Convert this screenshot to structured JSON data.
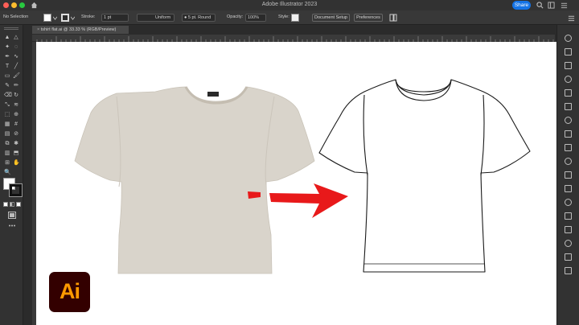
{
  "window": {
    "title": "Adobe Illustrator 2023",
    "share_label": "Share"
  },
  "control_bar": {
    "selection_label": "No Selection",
    "stroke_label": "Stroke:",
    "stroke_weight": "1 pt",
    "profile_value": "Uniform",
    "brush_value": "5 pt. Round",
    "opacity_label": "Opacity:",
    "opacity_value": "100%",
    "style_label": "Style:",
    "document_setup_label": "Document Setup",
    "preferences_label": "Preferences"
  },
  "document_tab": {
    "label": "tshirt flat.ai @ 33.33 % (RGB/Preview)"
  },
  "artwork": {
    "logo_text": "Ai",
    "photo_tshirt_color": "#d9d4cb",
    "arrow_color": "#e8191a",
    "logo_bg": "#330000",
    "logo_fg": "#ff9a00"
  },
  "icons": {
    "left_toolbar": [
      "selection-tool-icon",
      "direct-selection-tool-icon",
      "magic-wand-icon",
      "lasso-icon",
      "pen-tool-icon",
      "curvature-tool-icon",
      "type-tool-icon",
      "line-segment-icon",
      "rectangle-tool-icon",
      "paintbrush-icon",
      "shaper-tool-icon",
      "pencil-icon",
      "eraser-icon",
      "rotate-tool-icon",
      "scale-tool-icon",
      "width-tool-icon",
      "free-transform-icon",
      "shape-builder-icon",
      "perspective-grid-icon",
      "mesh-tool-icon",
      "gradient-tool-icon",
      "eyedropper-icon",
      "blend-tool-icon",
      "symbol-sprayer-icon",
      "column-graph-icon",
      "artboard-tool-icon",
      "slice-tool-icon",
      "hand-tool-icon",
      "zoom-tool-icon"
    ],
    "right_panel": [
      "properties-icon",
      "layers-icon",
      "libraries-icon",
      "color-icon",
      "swatches-icon",
      "brushes-icon",
      "symbols-icon",
      "graphic-styles-icon",
      "appearance-icon",
      "transparency-icon",
      "stroke-panel-icon",
      "gradient-panel-icon",
      "align-icon",
      "pathfinder-icon",
      "transform-icon",
      "artboards-icon",
      "links-icon",
      "asset-export-icon"
    ]
  }
}
